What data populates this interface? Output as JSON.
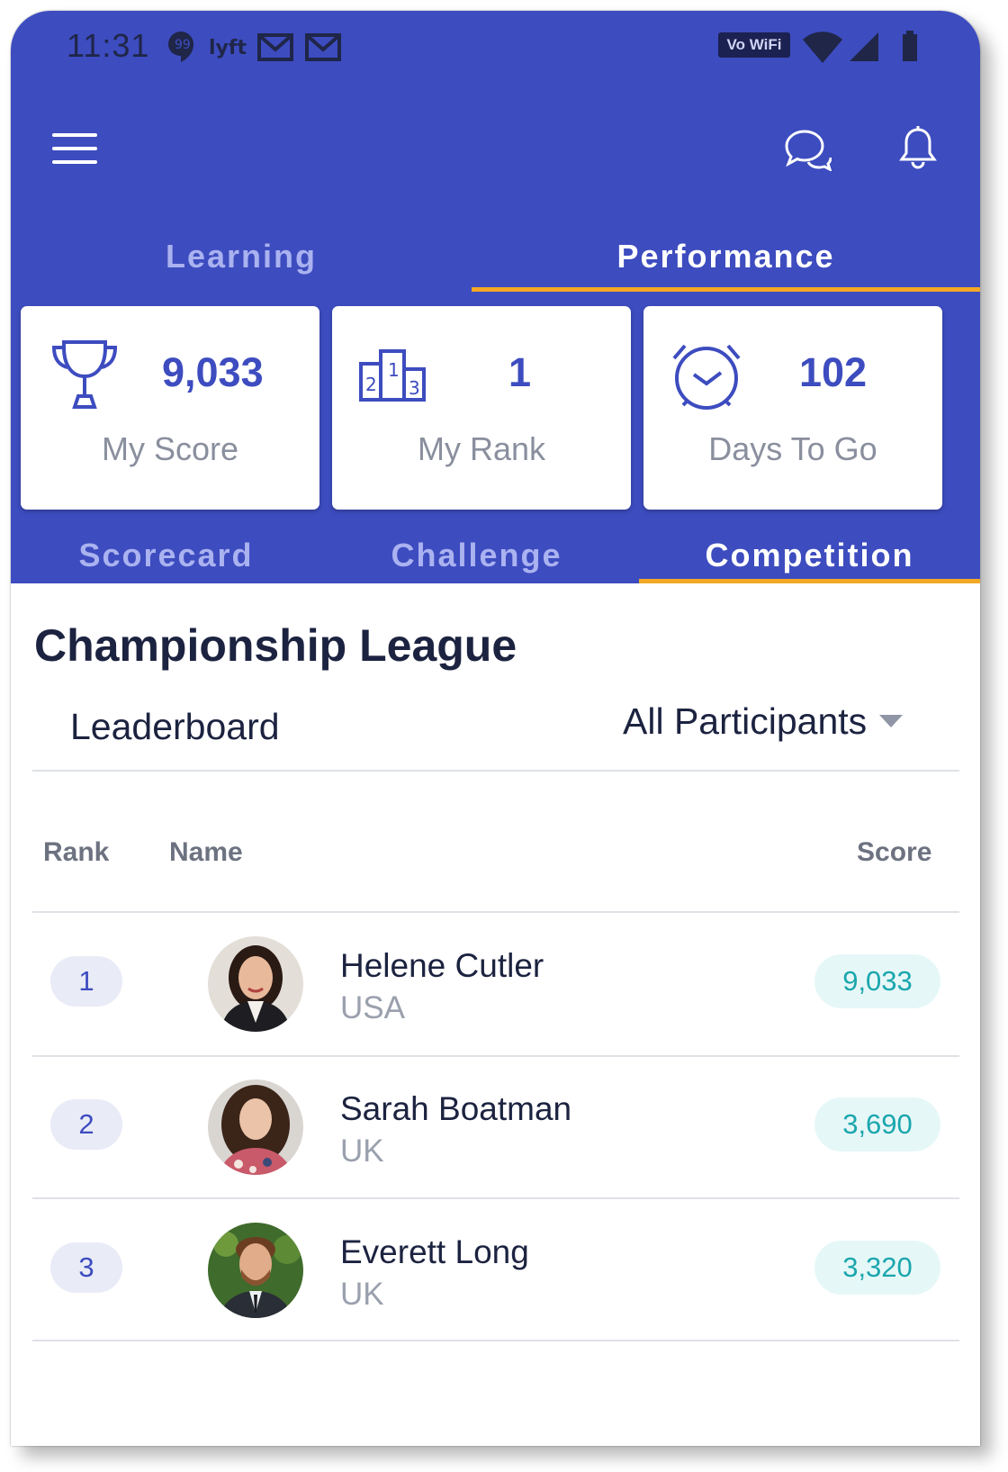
{
  "status_bar": {
    "time": "11:31",
    "vowifi": "Vo WiFi"
  },
  "tabs": {
    "learning": "Learning",
    "performance": "Performance"
  },
  "stats": [
    {
      "icon": "trophy-icon",
      "value": "9,033",
      "label": "My Score"
    },
    {
      "icon": "podium-icon",
      "value": "1",
      "label": "My Rank"
    },
    {
      "icon": "alarm-clock-icon",
      "value": "102",
      "label": "Days To Go"
    }
  ],
  "sub_tabs": {
    "scorecard": "Scorecard",
    "challenge": "Challenge",
    "competition": "Competition"
  },
  "league": {
    "title": "Championship League",
    "leaderboard_label": "Leaderboard",
    "filter_value": "All Participants"
  },
  "table": {
    "headers": {
      "rank": "Rank",
      "name": "Name",
      "score": "Score"
    },
    "rows": [
      {
        "rank": "1",
        "name": "Helene Cutler",
        "country": "USA",
        "score": "9,033"
      },
      {
        "rank": "2",
        "name": "Sarah Boatman",
        "country": "UK",
        "score": "3,690"
      },
      {
        "rank": "3",
        "name": "Everett Long",
        "country": "UK",
        "score": "3,320"
      }
    ]
  },
  "colors": {
    "brand_blue": "#3d4cbf",
    "accent_orange": "#f3a825",
    "score_teal": "#1aa6ad"
  }
}
